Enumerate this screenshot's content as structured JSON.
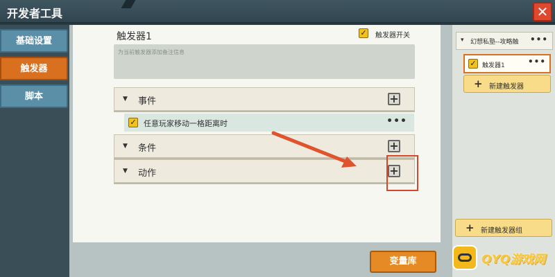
{
  "titlebar": {
    "title": "开发者工具",
    "close_label": "✕"
  },
  "sidebar": {
    "tabs": [
      {
        "label": "基础设置",
        "active": false
      },
      {
        "label": "触发器",
        "active": true
      },
      {
        "label": "脚本",
        "active": false
      }
    ]
  },
  "main": {
    "trigger_name": "触发器1",
    "trigger_switch_label": "触发器开关",
    "trigger_switch_checked": true,
    "description_placeholder": "为当前触发器添加备注信息",
    "sections": {
      "event": {
        "label": "事件",
        "add_label": "+"
      },
      "condition": {
        "label": "条件",
        "add_label": "+"
      },
      "action": {
        "label": "动作",
        "add_label": "+"
      }
    },
    "event_items": [
      {
        "text": "任意玩家移动一格距离时",
        "checked": true,
        "more": "•••"
      }
    ],
    "variable_library_button": "变量库"
  },
  "right_panel": {
    "group_header": {
      "chevron": "▾",
      "label": "幻想私塾--攻略触",
      "more": "•••"
    },
    "trigger_item": {
      "label": "触发器1",
      "checked": true,
      "more": "•••"
    },
    "new_trigger_button": "新建触发器",
    "new_group_button": "新建触发器组"
  },
  "watermark": {
    "text": "QYQ游戏网"
  },
  "colors": {
    "accent_orange": "#d8701f",
    "tab_blue": "#5b8fa8",
    "checkbox_yellow": "#f1c11c",
    "highlight_red": "#d6462b"
  }
}
